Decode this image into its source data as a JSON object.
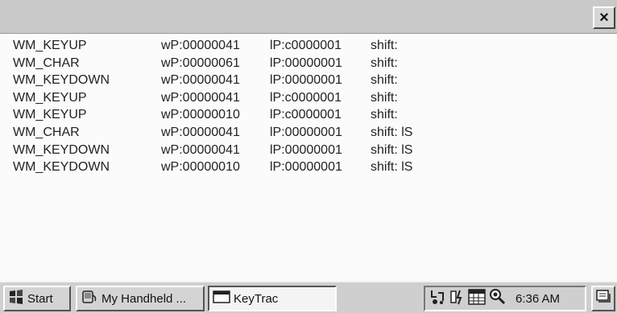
{
  "title_bar": {
    "close_label": "×",
    "close_icon": "close-icon"
  },
  "log": {
    "rows": [
      {
        "msg": "WM_KEYUP",
        "wp": "wP:00000041",
        "lp": "lP:c0000001",
        "shift": "shift:"
      },
      {
        "msg": "WM_CHAR",
        "wp": "wP:00000061",
        "lp": "lP:00000001",
        "shift": "shift:"
      },
      {
        "msg": "WM_KEYDOWN",
        "wp": "wP:00000041",
        "lp": "lP:00000001",
        "shift": "shift:"
      },
      {
        "msg": "WM_KEYUP",
        "wp": "wP:00000041",
        "lp": "lP:c0000001",
        "shift": "shift:"
      },
      {
        "msg": "WM_KEYUP",
        "wp": "wP:00000010",
        "lp": "lP:c0000001",
        "shift": "shift:"
      },
      {
        "msg": "WM_CHAR",
        "wp": "wP:00000041",
        "lp": "lP:00000001",
        "shift": "shift: lS"
      },
      {
        "msg": "WM_KEYDOWN",
        "wp": "wP:00000041",
        "lp": "lP:00000001",
        "shift": "shift: lS"
      },
      {
        "msg": "WM_KEYDOWN",
        "wp": "wP:00000010",
        "lp": "lP:00000001",
        "shift": "shift: lS"
      }
    ]
  },
  "taskbar": {
    "start_label": "Start",
    "start_icon": "windows-flag-icon",
    "my_handheld_label": "My Handheld ...",
    "my_handheld_icon": "handheld-icon",
    "keytrac_label": "KeyTrac",
    "keytrac_icon": "window-icon",
    "tray_icons": [
      "network-icon",
      "power-icon",
      "calendar-icon",
      "magnifier-icon"
    ],
    "clock": "6:36 AM",
    "desktop_icon": "desktop-icon"
  },
  "colors": {
    "title_bar": "#c9c9c9",
    "taskbar": "#cfcfcf",
    "background": "#fbfbfb"
  }
}
